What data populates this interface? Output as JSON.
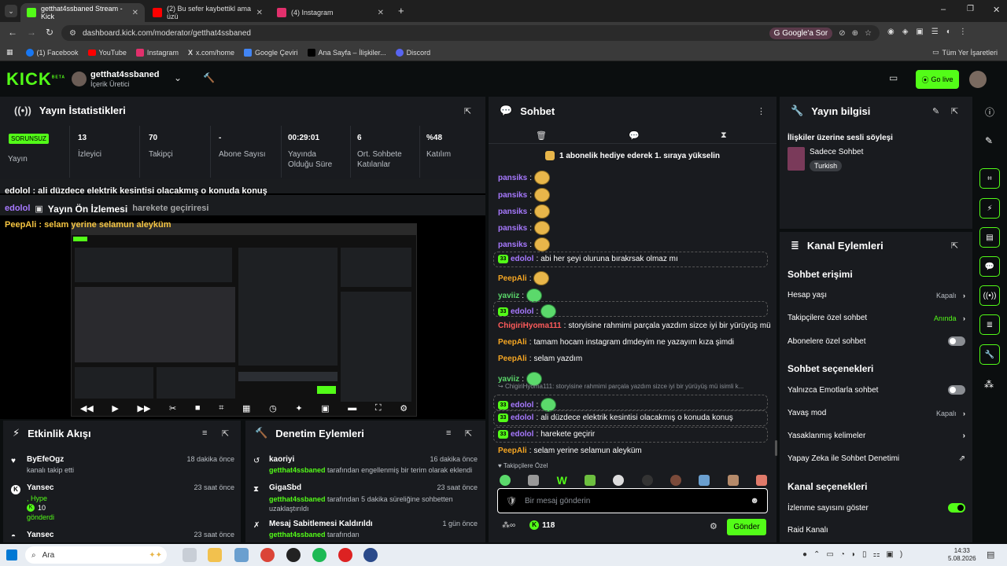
{
  "tabs": [
    {
      "label": "getthat4ssbaned Stream - Kick"
    },
    {
      "label": "(2) Bu sefer kaybettikl ama üzü"
    },
    {
      "label": "(4) Instagram"
    }
  ],
  "url": "dashboard.kick.com/moderator/getthat4ssbaned",
  "google_btn": "Google'a Sor",
  "bookmarks": [
    "(1) Facebook",
    "YouTube",
    "Instagram",
    "x.com/home",
    "Google Çeviri",
    "Ana Sayfa – İlişkiler...",
    "Discord"
  ],
  "bookmarks_all": "Tüm Yer İşaretleri",
  "kick": {
    "logo": "KICK",
    "beta": "BETA",
    "channel": "getthat4ssbaned",
    "role": "İçerik Üretici",
    "golive": "Go live"
  },
  "stats": {
    "title": "Yayın İstatistikleri",
    "status": "SORUNSUZ",
    "status_label": "Yayın",
    "items": [
      {
        "v": "13",
        "l": "İzleyici"
      },
      {
        "v": "70",
        "l": "Takipçi"
      },
      {
        "v": "-",
        "l": "Abone Sayısı"
      },
      {
        "v": "00:29:01",
        "l": "Yayında Olduğu Süre"
      },
      {
        "v": "6",
        "l": "Ort. Sohbete Katılanlar"
      },
      {
        "v": "%48",
        "l": "Katılım"
      }
    ]
  },
  "overlay": {
    "l1": "edolol : ali düzdece elektrik kesintisi olacakmış o konuda konuş",
    "l2a": "edolol",
    "l2b": "harekete geçiriresi",
    "l2c": "Yayın Ön İzlemesi",
    "l3": "PeepAli : selam yerine selamun aleyküm"
  },
  "activity": {
    "title": "Etkinlik Akışı",
    "items": [
      {
        "user": "ByEfeOgz",
        "time": "18 dakika önce",
        "desc": "kanalı takip etti"
      },
      {
        "user": "Yansec",
        "time": "23 saat önce",
        "desc": ", Hype",
        "amount": "10",
        "extra": "gönderdi"
      },
      {
        "user": "Yansec",
        "time": "23 saat önce"
      }
    ]
  },
  "mod": {
    "title": "Denetim Eylemleri",
    "items": [
      {
        "user": "kaoriyi",
        "time": "16 dakika önce",
        "by": "getthat4ssbaned",
        "desc": "tarafından engellenmiş bir terim olarak eklendi"
      },
      {
        "user": "GigaSbd",
        "time": "23 saat önce",
        "by": "getthat4ssbaned",
        "desc": "tarafından 5 dakika süreliğine sohbetten uzaklaştırıldı"
      },
      {
        "user": "Mesaj Sabitlemesi Kaldırıldı",
        "time": "1 gün önce",
        "by": "getthat4ssbaned",
        "desc": "tarafından"
      }
    ]
  },
  "chat": {
    "title": "Sohbet",
    "pinned": "1 abonelik hediye ederek 1. sıraya yükselin",
    "messages": [
      {
        "user": "pansiks",
        "text": "",
        "color": "#a779ff",
        "emote": true
      },
      {
        "user": "pansiks",
        "text": "",
        "color": "#a779ff",
        "emote": true
      },
      {
        "user": "pansiks",
        "text": "",
        "color": "#a779ff",
        "emote": true
      },
      {
        "user": "pansiks",
        "text": "",
        "color": "#a779ff",
        "emote": true
      },
      {
        "user": "pansiks",
        "text": "",
        "color": "#a779ff",
        "emote": true
      },
      {
        "user": "edolol",
        "text": "abi her şeyi oluruna bırakrsak olmaz mı",
        "color": "#a779ff",
        "badge": true,
        "hl": true
      },
      {
        "user": "PeepAli",
        "text": "",
        "color": "#f5a623",
        "emote": true
      },
      {
        "user": "yaviiz",
        "text": "",
        "color": "#5bd96b",
        "emote": true
      },
      {
        "user": "edolol",
        "text": "",
        "color": "#a779ff",
        "badge": true,
        "hl": true,
        "emote": true
      },
      {
        "user": "ChigiriHyoma111",
        "text": "storyisine rahmimi parçala yazdım sizce iyi bir yürüyüş mü",
        "color": "#ff5b5b"
      },
      {
        "user": "PeepAli",
        "text": "tamam hocam instagram dmdeyim ne yazayım kıza şimdi",
        "color": "#f5a623"
      },
      {
        "user": "PeepAli",
        "text": "selam yazdım",
        "color": "#f5a623"
      },
      {
        "user": "yaviiz",
        "text": "",
        "color": "#5bd96b",
        "emote": true
      },
      {
        "user": "edolol",
        "text": "",
        "color": "#a779ff",
        "badge": true,
        "hl": true,
        "emote": true
      },
      {
        "user": "edolol",
        "text": "ali düzdece elektrik kesintisi olacakmış o konuda konuş",
        "color": "#a779ff",
        "badge": true,
        "hl": true
      },
      {
        "user": "edolol",
        "text": "harekete geçirir",
        "color": "#a779ff",
        "badge": true,
        "hl": true
      },
      {
        "user": "PeepAli",
        "text": "selam yerine selamun aleyküm",
        "color": "#f5a623"
      }
    ],
    "reply": "ChigiriHyoma111: storyisine rahmimi parçala yazdım sizce iyi bir yürüyüş mü isimli k...",
    "follower_only": "Takipçilere Özel",
    "placeholder": "Bir mesaj gönderin",
    "count": "118",
    "send": "Gönder"
  },
  "info": {
    "title": "Yayın bilgisi",
    "stream_title": "İlişkiler üzerine sesli söyleşi",
    "category": "Sadece Sohbet",
    "tag": "Turkish"
  },
  "actions": {
    "title": "Kanal Eylemleri",
    "chat_access": "Sohbet erişimi",
    "account_age": "Hesap yaşı",
    "account_age_v": "Kapalı",
    "followers_only": "Takipçilere özel sohbet",
    "followers_only_v": "Anında",
    "subs_only": "Abonelere özel sohbet",
    "chat_options": "Sohbet seçenekleri",
    "emote_only": "Yalnızca Emotlarla sohbet",
    "slow": "Yavaş mod",
    "slow_v": "Kapalı",
    "banned_words": "Yasaklanmış kelimeler",
    "ai_mod": "Yapay Zeka ile Sohbet Denetimi",
    "channel_options": "Kanal seçenekleri",
    "show_viewers": "İzlenme sayısını göster",
    "raid": "Raid Kanalı"
  },
  "taskbar": {
    "search": "Ara",
    "time": "14:33",
    "date": "5.08.2026"
  },
  "colors": {
    "accent": "#53fc18",
    "panel": "#191b1f",
    "bg": "#0b0e0f"
  }
}
